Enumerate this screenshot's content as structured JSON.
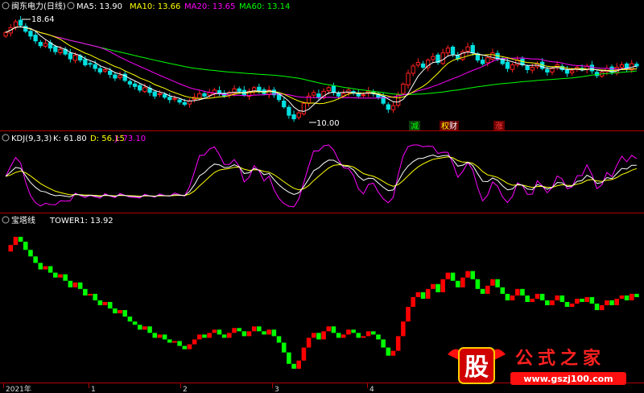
{
  "header": {
    "main_title": "闽东电力(日线)",
    "ma_labels": [
      {
        "text": "MA5: 13.90",
        "color": "#ffffff"
      },
      {
        "text": "MA10: 13.66",
        "color": "#ffff00"
      },
      {
        "text": "MA20: 13.65",
        "color": "#ff00ff"
      },
      {
        "text": "MA60: 13.14",
        "color": "#00ff00"
      }
    ],
    "kdj_label": "KDJ(9,3,3)",
    "kdj_values": [
      {
        "text": "K: 61.80",
        "color": "#ffffff"
      },
      {
        "text": "D: 56.15",
        "color": "#ffff00"
      },
      {
        "text": "J: 73.10",
        "color": "#ff00ff"
      }
    ],
    "tower_label": "宝塔线",
    "tower_value": "TOWER1: 13.92"
  },
  "annotations": {
    "high_price": "18.64",
    "low_price": "10.00",
    "event_tags": [
      {
        "text": "减",
        "color": "#00ff00",
        "bg": "#0b3d0b"
      },
      {
        "text": "权",
        "color": "#ffff00",
        "bg": "#6a0000"
      },
      {
        "text": "财",
        "color": "#ffffff",
        "bg": "#6a0000"
      },
      {
        "text": "涨",
        "color": "#ff4040",
        "bg": "#6a0000"
      }
    ]
  },
  "x_axis": {
    "labels": [
      "2021年",
      "1",
      "2",
      "3",
      "4"
    ]
  },
  "watermark": {
    "big_char": "股",
    "title": "公式之家",
    "url": "www.gszj100.com"
  },
  "colors": {
    "up": "#ff2020",
    "down": "#00e0e0",
    "tower_up": "#ff0000",
    "tower_down": "#00ff00",
    "ma5": "#ffffff",
    "ma10": "#ffff00",
    "ma20": "#ff00ff",
    "ma60": "#00ff00",
    "divider": "#b00000"
  },
  "chart_data": [
    {
      "type": "candlestick",
      "title": "闽东电力(日线)",
      "x": [
        "2021年",
        "1",
        "2",
        "3",
        "4"
      ],
      "price_range": [
        10.0,
        18.64
      ],
      "series": [
        {
          "name": "MA5",
          "last": 13.9
        },
        {
          "name": "MA10",
          "last": 13.66
        },
        {
          "name": "MA20",
          "last": 13.65
        },
        {
          "name": "MA60",
          "last": 13.14
        }
      ],
      "close": [
        17.5,
        17.9,
        18.4,
        18.1,
        17.6,
        17.2,
        16.8,
        16.4,
        16.6,
        16.2,
        15.9,
        16.1,
        15.7,
        15.3,
        15.6,
        15.2,
        14.8,
        14.9,
        14.5,
        14.2,
        14.4,
        14.0,
        13.7,
        13.9,
        13.5,
        13.2,
        13.0,
        12.7,
        12.9,
        12.5,
        12.2,
        12.4,
        12.1,
        11.9,
        12.0,
        11.7,
        11.5,
        11.8,
        12.1,
        12.4,
        12.2,
        12.5,
        12.7,
        12.4,
        12.2,
        12.5,
        12.8,
        12.6,
        12.3,
        12.6,
        12.9,
        12.6,
        12.4,
        12.7,
        12.3,
        11.9,
        11.3,
        10.6,
        10.3,
        10.8,
        11.6,
        12.2,
        12.5,
        12.1,
        12.6,
        12.9,
        12.5,
        12.2,
        12.4,
        12.7,
        12.5,
        12.2,
        12.3,
        12.6,
        12.4,
        12.1,
        11.6,
        11.1,
        11.4,
        12.3,
        13.2,
        14.1,
        14.7,
        15.0,
        14.6,
        15.2,
        15.5,
        15.0,
        15.8,
        16.2,
        15.7,
        15.3,
        15.9,
        16.3,
        15.8,
        15.2,
        14.9,
        15.4,
        15.8,
        15.3,
        14.9,
        14.5,
        14.8,
        15.2,
        14.8,
        14.4,
        14.6,
        14.9,
        14.5,
        14.2,
        14.5,
        14.8,
        14.4,
        14.1,
        14.3,
        14.6,
        14.4,
        14.7,
        14.3,
        13.9,
        14.2,
        14.5,
        14.2,
        14.6,
        14.8,
        14.5,
        14.9,
        14.7
      ]
    },
    {
      "type": "line",
      "title": "KDJ(9,3,3)",
      "series": [
        {
          "name": "K",
          "last": 61.8
        },
        {
          "name": "D",
          "last": 56.15
        },
        {
          "name": "J",
          "last": 73.1
        }
      ],
      "ylim": [
        0,
        100
      ]
    },
    {
      "type": "bar",
      "title": "宝塔线",
      "series": [
        {
          "name": "TOWER1",
          "last": 13.92
        }
      ]
    }
  ]
}
